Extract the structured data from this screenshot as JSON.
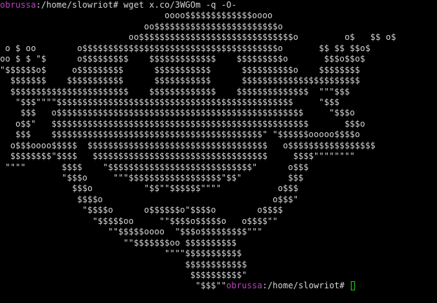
{
  "prompt": {
    "user_host": "obrussa",
    "path": ":/home/slowriot#",
    "command": " wget x.co/3WGOm -q -O-"
  },
  "art_lines": [
    "                                oooo$$$$$$$$$$$$$oooo",
    "                            oo$$$$$$$$$$$$$$$$$$$$$$$$o",
    "                         oo$$$$$$$$$$$$$$$$$$$$$$$$$$$$$$o         o$   $$ o$",
    " o $ oo        o$$$$$$$$$$$$$$$$$$$$$$$$$$$$$$$$$$$$$$o       $$ $$ $$o$",
    "oo $ $ \"$      o$$$$$$$$$    $$$$$$$$$$$$$    $$$$$$$$$o       $$$o$$o$",
    "\"$$$$$$o$     o$$$$$$$$$      $$$$$$$$$$$      $$$$$$$$$$o    $$$$$$$$",
    "  $$$$$$$    $$$$$$$$$$$      $$$$$$$$$$$      $$$$$$$$$$$$$$$$$$$$$$$",
    "  $$$$$$$$$$$$$$$$$$$$$$$    $$$$$$$$$$$$$    $$$$$$$$$$$$$$  \"\"\"$$$",
    "   \"$$$\"\"\"\"$$$$$$$$$$$$$$$$$$$$$$$$$$$$$$$$$$$$$$$$$$$$$$     \"$$$",
    "    $$$   o$$$$$$$$$$$$$$$$$$$$$$$$$$$$$$$$$$$$$$$$$$$$$$$$     \"$$$o",
    "   o$$\"   $$$$$$$$$$$$$$$$$$$$$$$$$$$$$$$$$$$$$$$$$$$$$$$$$$       $$$o",
    "   $$$    $$$$$$$$$$$$$$$$$$$$$$$$$$$$$$$$$$$$$$$$$\" \"$$$$$$ooooo$$$$o",
    "  o$$$oooo$$$$$  $$$$$$$$$$$$$$$$$$$$$$$$$$$$$$$$$$$   o$$$$$$$$$$$$$$$$$",
    "  $$$$$$$$\"$$$$   $$$$$$$$$$$$$$$$$$$$$$$$$$$$$$$$$$     $$$$\"\"\"\"\"\"\"\"",
    " \"\"\"\"       $$$$    \"$$$$$$$$$$$$$$$$$$$$$$$$$$$$\"      o$$$",
    "            \"$$$o     \"\"\"$$$$$$$$$$$$$$$$$$\"$$\"         $$$",
    "              $$$o          \"$$\"\"$$$$$$\"\"\"\"           o$$$",
    "               $$$$o                                 o$$$\"",
    "                \"$$$$o      o$$$$$$o\"$$$$o        o$$$$",
    "                  \"$$$$$oo     \"\"$$$$o$$$$$o   o$$$$\"\"",
    "                     \"\"$$$$$oooo  \"$$$o$$$$$$$$$\"\"\"",
    "                        \"\"$$$$$$$oo $$$$$$$$$$",
    "                                \"\"\"\"$$$$$$$$$$$",
    "                                    $$$$$$$$$$$$",
    "                                     $$$$$$$$$$\""
  ],
  "final_art": "                                      \"$$$\"\"",
  "final_prompt": {
    "user_host": "obrussa",
    "path": ":/home/slowriot#",
    "trailing": " "
  },
  "colors": {
    "background": "#000000",
    "text": "#d6d6d6",
    "prompt_user": "#c040c0",
    "cursor": "#19d119"
  }
}
